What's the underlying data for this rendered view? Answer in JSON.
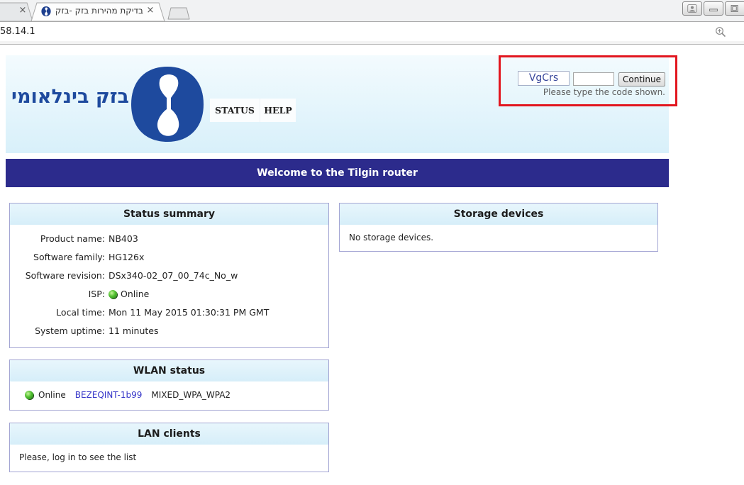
{
  "browser": {
    "tabs": [
      {
        "close_glyph": "×"
      },
      {
        "title": "בדיקת מהירות בזק -בזק",
        "close_glyph": "×",
        "favicon": "bezeq-favicon-icon",
        "active": true
      }
    ],
    "new_tab_icon": "new-tab-icon",
    "address_bar": {
      "url": "58.14.1"
    },
    "toolbar_icons": [
      "zoom-icon"
    ],
    "window_controls": [
      "profile-icon",
      "minimize-icon",
      "maximize-icon"
    ]
  },
  "header": {
    "brand_name": "בזק בינלאומי",
    "logo_icon": "bezeq-logo",
    "menu": [
      {
        "label": "STATUS"
      },
      {
        "label": "HELP"
      }
    ]
  },
  "captcha": {
    "code": "VgCrs",
    "button_label": "Continue",
    "hint": "Please type the code shown."
  },
  "banner": {
    "title": "Welcome to the Tilgin router"
  },
  "status_summary": {
    "title": "Status summary",
    "rows": [
      {
        "label": "Product name:",
        "value": "NB403"
      },
      {
        "label": "Software family:",
        "value": "HG126x"
      },
      {
        "label": "Software revision:",
        "value": "DSx340-02_07_00_74c_No_w"
      },
      {
        "label": "ISP:",
        "value": "Online",
        "icon": "online-status-icon"
      },
      {
        "label": "Local time:",
        "value": "Mon 11 May 2015 01:30:31 PM GMT"
      },
      {
        "label": "System uptime:",
        "value": "11 minutes"
      }
    ]
  },
  "storage_devices": {
    "title": "Storage devices",
    "message": "No storage devices."
  },
  "wlan_status": {
    "title": "WLAN status",
    "state": "Online",
    "state_icon": "online-status-icon",
    "ssid": "BEZEQINT-1b99",
    "security": "MIXED_WPA_WPA2"
  },
  "lan_clients": {
    "title": "LAN clients",
    "message": "Please, log in to see the list"
  },
  "colors": {
    "brand_blue": "#1e4a9e",
    "banner_navy": "#2c2b8c",
    "highlight_red": "#e2161f",
    "panel_header": "#d6eef9",
    "panel_border": "#a3a5d3",
    "link_blue": "#3535c8",
    "online_green": "#4fbf2f"
  }
}
